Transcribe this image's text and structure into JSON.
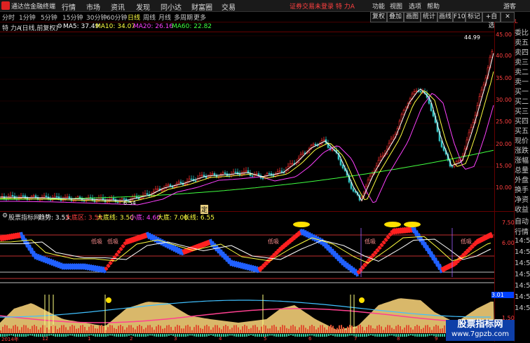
{
  "menubar": {
    "app_title": "通达信金融终端",
    "menus": [
      "行情",
      "市场",
      "资讯",
      "发现",
      "同小达",
      "财富圈",
      "交易"
    ],
    "login_status": "证券交易未登录",
    "stock_short": "特 力A",
    "right_menus": [
      "功能",
      "视图",
      "选项",
      "帮助"
    ],
    "guest": "游客"
  },
  "periods": [
    "分时",
    "1分钟",
    "5分钟",
    "15分钟",
    "30分钟",
    "60分钟",
    "日线",
    "周线",
    "月线",
    "多周期",
    "更多"
  ],
  "active_period": "日线",
  "toolbar": [
    "复权",
    "叠加",
    "画图",
    "统计",
    "画线",
    "F10",
    "标记",
    "+自选"
  ],
  "info": {
    "stock": "特 力A",
    "mode": "(日线,前复权)",
    "ma5_label": "MA5: 37.49",
    "ma10_label": "MA10: 34.07",
    "ma20_label": "MA20: 26.16",
    "ma60_label": "MA60: 22.82"
  },
  "price_marks": {
    "high": "44.99",
    "low": "6.54"
  },
  "y_main": [
    "45.00",
    "40.00",
    "35.00",
    "30.00",
    "25.00",
    "20.00",
    "15.00",
    "10.00"
  ],
  "orderbook": [
    "委比",
    "卖五",
    "卖四",
    "卖三",
    "卖二",
    "卖一",
    "买一",
    "买二",
    "买三",
    "买四",
    "买五",
    "现价",
    "涨跌",
    "涨幅",
    "总量",
    "外盘",
    "换手",
    "净资",
    "收益",
    "自动",
    "行情"
  ],
  "orderbook_tag": "L",
  "indicator1": {
    "title": "股票指标网",
    "trend": "趋势: 3.53",
    "dadiqu": "大底区: 3.50",
    "dadixian": "大底线: 3.50",
    "xiaodi": "小底: 4.60",
    "dadi": "大底: 7.00",
    "changxian": "长线: 6.55",
    "low_labels": [
      "低吸",
      "低吸",
      "低吸",
      "低吸",
      "低吸"
    ],
    "ding_label": "定",
    "y_ticks": [
      "7.50",
      "6.00"
    ]
  },
  "times": [
    "14:50",
    "14:50",
    "14:50",
    "14:50",
    "14:50",
    "14:50",
    "14:50"
  ],
  "indicator2": {
    "value": "3.01",
    "y_ticks": [
      "1.50"
    ]
  },
  "xaxis": [
    "2014年",
    "12",
    "1",
    "2",
    "3",
    "4",
    "5",
    "6",
    "7",
    "8",
    "9"
  ],
  "watermark": {
    "title": "股票指标网",
    "url": "www.7gpzb.com"
  },
  "colors": {
    "up": "#ff3030",
    "down": "#30c0c0",
    "ma5": "#ffffff",
    "ma10": "#ffff40",
    "ma20": "#ff40ff",
    "ma60": "#40ff40",
    "grid": "#600000"
  }
}
